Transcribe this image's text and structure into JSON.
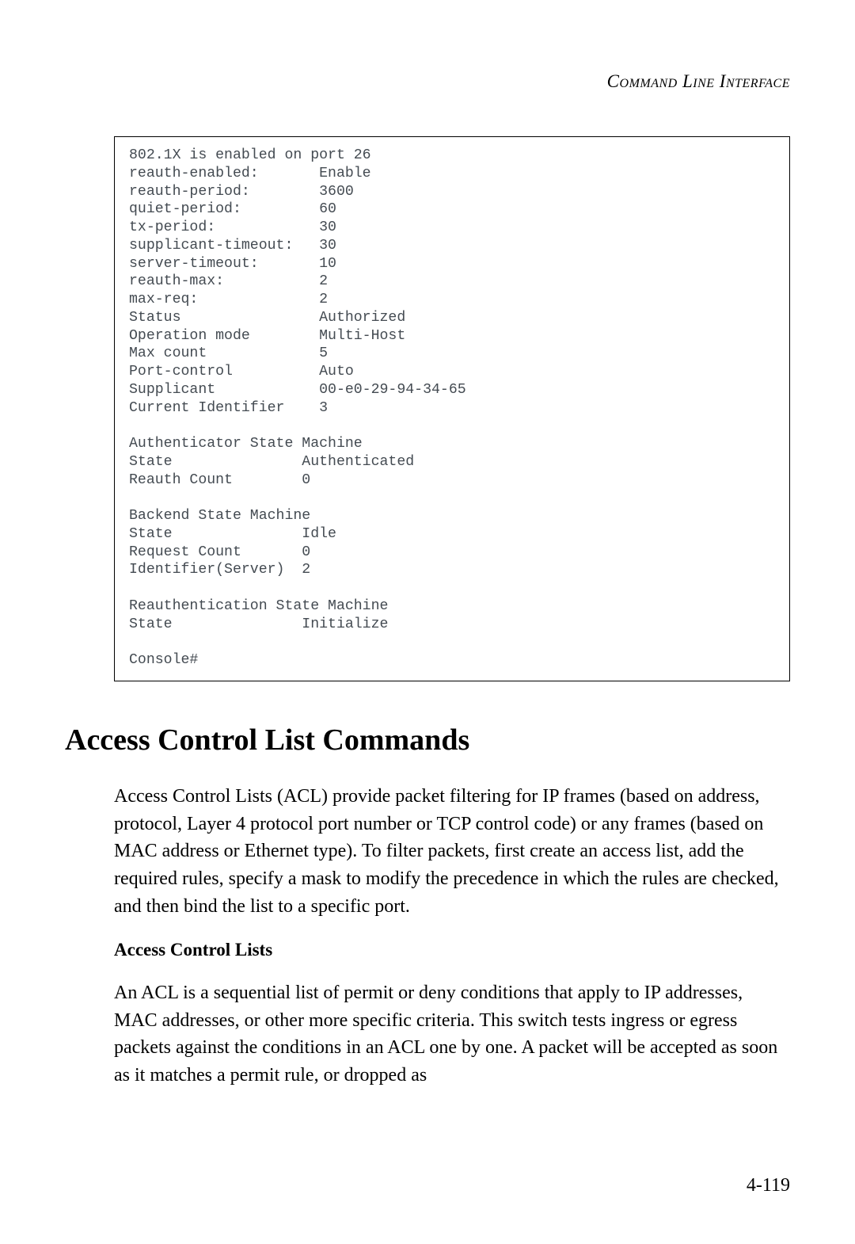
{
  "header": {
    "running_title": "Command Line Interface"
  },
  "console": {
    "text": "802.1X is enabled on port 26\nreauth-enabled:       Enable\nreauth-period:        3600\nquiet-period:         60\ntx-period:            30\nsupplicant-timeout:   30\nserver-timeout:       10\nreauth-max:           2\nmax-req:              2\nStatus                Authorized\nOperation mode        Multi-Host\nMax count             5\nPort-control          Auto\nSupplicant            00-e0-29-94-34-65\nCurrent Identifier    3\n\nAuthenticator State Machine\nState               Authenticated\nReauth Count        0\n\nBackend State Machine\nState               Idle\nRequest Count       0\nIdentifier(Server)  2\n\nReauthentication State Machine\nState               Initialize\n\nConsole#"
  },
  "section": {
    "title": "Access Control List Commands",
    "paragraph1": "Access Control Lists (ACL) provide packet filtering for IP frames (based on address, protocol, Layer 4 protocol port number or TCP control code) or any frames (based on MAC address or Ethernet type). To filter packets, first create an access list, add the required rules, specify a mask to modify the precedence in which the rules are checked, and then bind the list to a specific port.",
    "subheading": "Access Control Lists",
    "paragraph2": "An ACL is a sequential list of permit or deny conditions that apply to IP addresses, MAC addresses, or other more specific criteria. This switch tests ingress or egress packets against the conditions in an ACL one by one. A packet will be accepted as soon as it matches a permit rule, or dropped as"
  },
  "footer": {
    "page_number": "4-119"
  }
}
